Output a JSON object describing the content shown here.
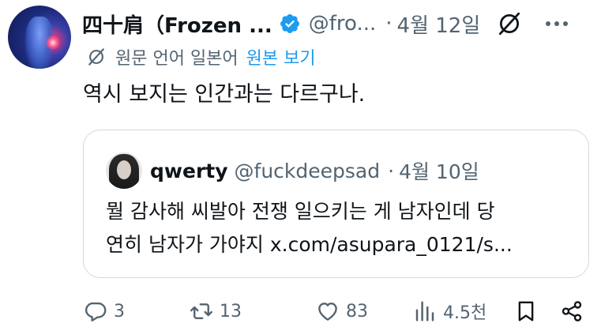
{
  "author": {
    "display_name": "四十肩（Frozen ...",
    "handle": "@fro...",
    "separator": "·",
    "date": "4월 12일"
  },
  "translation": {
    "language_note": "원문 언어 일본어",
    "show_original_label": "원본 보기"
  },
  "tweet_text": "역시 보지는 인간과는 다르구나.",
  "quoted": {
    "name": "qwerty",
    "handle": "@fuckdeepsad",
    "separator": "·",
    "date": "4월 10일",
    "text_line1": "뭘 감사해 씨발아 전쟁 일으키는 게 남자인데 당",
    "text_line2": "연히 남자가 가야지 x.com/asupara_0121/s..."
  },
  "actions": {
    "reply_count": "3",
    "retweet_count": "13",
    "like_count": "83",
    "view_count": "4.5천"
  },
  "icons": [
    "verified-icon",
    "grok-icon",
    "more-icon",
    "translate-icon",
    "reply-icon",
    "retweet-icon",
    "like-icon",
    "views-icon",
    "bookmark-icon",
    "share-icon"
  ],
  "colors": {
    "accent": "#1d9bf0",
    "secondary_text": "#536471",
    "border": "#cfd9de"
  }
}
